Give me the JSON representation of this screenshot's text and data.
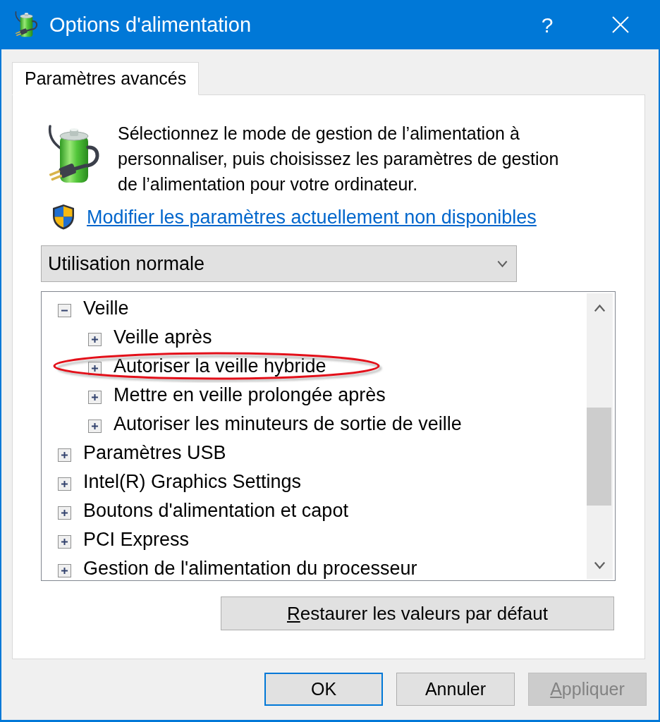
{
  "window": {
    "title": "Options d'alimentation",
    "help_button": "?"
  },
  "tabs": [
    {
      "label": "Paramètres avancés",
      "selected": true
    }
  ],
  "intro": {
    "text": "Sélectionnez le mode de gestion de l’alimentation à personnaliser, puis choisissez les paramètres de gestion de l’alimentation pour votre ordinateur.",
    "link": "Modifier les paramètres actuellement non disponibles"
  },
  "plan_select": {
    "value": "Utilisation normale"
  },
  "tree": {
    "items": [
      {
        "label": "Veille",
        "expanded": true,
        "highlighted": false,
        "children": [
          {
            "label": "Veille après",
            "expanded": false,
            "highlighted": false
          },
          {
            "label": "Autoriser la veille hybride",
            "expanded": false,
            "highlighted": true
          },
          {
            "label": "Mettre en veille prolongée après",
            "expanded": false,
            "highlighted": false
          },
          {
            "label": "Autoriser les minuteurs de sortie de veille",
            "expanded": false,
            "highlighted": false
          }
        ]
      },
      {
        "label": "Paramètres USB",
        "expanded": false,
        "highlighted": false
      },
      {
        "label": "Intel(R) Graphics Settings",
        "expanded": false,
        "highlighted": false
      },
      {
        "label": "Boutons d'alimentation et capot",
        "expanded": false,
        "highlighted": false
      },
      {
        "label": "PCI Express",
        "expanded": false,
        "highlighted": false
      },
      {
        "label": "Gestion de l'alimentation du processeur",
        "expanded": false,
        "highlighted": false
      }
    ]
  },
  "restore_button": {
    "label": "Restaurer les valeurs par défaut",
    "access_key_underlined": true
  },
  "buttons": [
    {
      "label": "OK",
      "default": true,
      "disabled": false,
      "access_key_underlined": false
    },
    {
      "label": "Annuler",
      "default": false,
      "disabled": false,
      "access_key_underlined": false
    },
    {
      "label": "Appliquer",
      "default": false,
      "disabled": true,
      "access_key_underlined": true
    }
  ]
}
